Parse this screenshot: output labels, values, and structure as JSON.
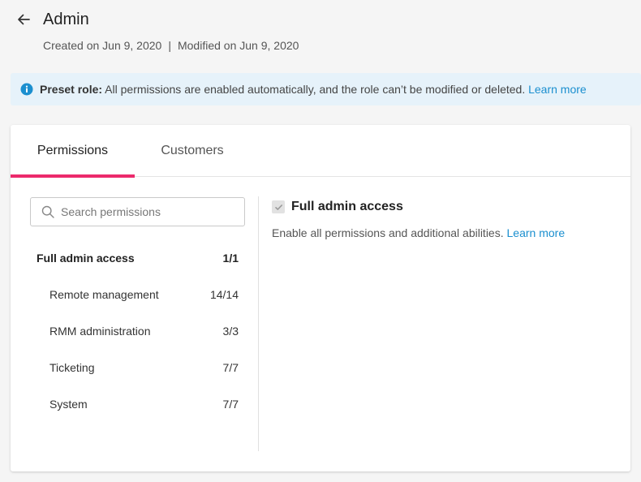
{
  "header": {
    "title": "Admin",
    "created": "Created on Jun 9, 2020",
    "separator": "|",
    "modified": "Modified on Jun 9, 2020"
  },
  "banner": {
    "label": "Preset role:",
    "message": "All permissions are enabled automatically, and the role can’t be modified or deleted.",
    "link": "Learn more",
    "icon": "info-icon",
    "bg_color": "#e6f2fa",
    "icon_color": "#1b8fcf"
  },
  "tabs": [
    {
      "label": "Permissions",
      "active": true
    },
    {
      "label": "Customers",
      "active": false
    }
  ],
  "accent_color": "#ec2a6c",
  "link_color": "#1b8fcf",
  "search": {
    "placeholder": "Search permissions",
    "value": ""
  },
  "permissions": [
    {
      "label": "Full admin access",
      "count": "1/1",
      "level": "top"
    },
    {
      "label": "Remote management",
      "count": "14/14",
      "level": "child"
    },
    {
      "label": "RMM administration",
      "count": "3/3",
      "level": "child"
    },
    {
      "label": "Ticketing",
      "count": "7/7",
      "level": "child"
    },
    {
      "label": "System",
      "count": "7/7",
      "level": "child"
    }
  ],
  "detail": {
    "title": "Full admin access",
    "checked": true,
    "description": "Enable all permissions and additional abilities.",
    "link": "Learn more"
  }
}
